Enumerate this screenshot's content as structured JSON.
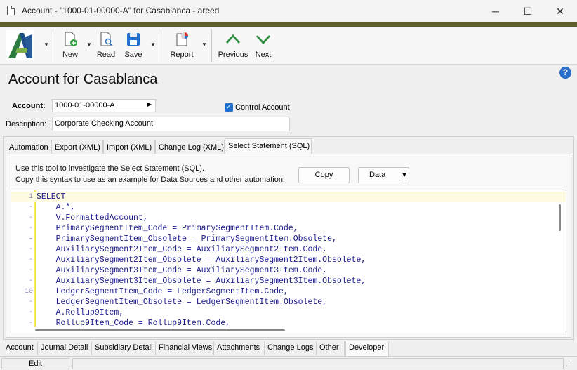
{
  "window": {
    "title": "Account - \"1000-01-00000-A\" for Casablanca - areed",
    "minimize": "─",
    "maximize": "☐",
    "close": "✕"
  },
  "toolbar": {
    "accent_color": "#5d5f2a",
    "buttons": [
      {
        "label": "New",
        "icon": "new-document-icon"
      },
      {
        "label": "Read",
        "icon": "read-document-icon"
      },
      {
        "label": "Save",
        "icon": "save-disk-icon"
      },
      {
        "label": "Report",
        "icon": "report-chart-icon"
      },
      {
        "label": "Previous",
        "icon": "chevron-up-icon"
      },
      {
        "label": "Next",
        "icon": "chevron-down-icon"
      }
    ]
  },
  "page": {
    "title": "Account for Casablanca",
    "help": "?"
  },
  "form": {
    "account_label": "Account:",
    "account_value": "1000-01-00000-A",
    "description_label": "Description:",
    "description_value": "Corporate Checking Account",
    "control_account_label": "Control Account",
    "control_account_checked": true
  },
  "upper_tabs": [
    "Automation",
    "Export (XML)",
    "Import (XML)",
    "Change Log (XML)",
    "Select Statement (SQL)"
  ],
  "active_upper_tab": "Select Statement (SQL)",
  "sql_panel": {
    "info_line1": "Use this tool to investigate the Select Statement (SQL).",
    "info_line2": "Copy this syntax to use as an example for Data Sources and other automation.",
    "copy_button": "Copy",
    "data_button": "Data"
  },
  "sql_lines": [
    {
      "num": "1",
      "text": "SELECT"
    },
    {
      "num": "-",
      "text": "    A.*,"
    },
    {
      "num": "-",
      "text": "    V.FormattedAccount,"
    },
    {
      "num": "-",
      "text": "    PrimarySegmentItem_Code = PrimarySegmentItem.Code,"
    },
    {
      "num": "–",
      "text": "    PrimarySegmentItem_Obsolete = PrimarySegmentItem.Obsolete,"
    },
    {
      "num": "-",
      "text": "    AuxiliarySegment2Item_Code = AuxiliarySegment2Item.Code,"
    },
    {
      "num": "-",
      "text": "    AuxiliarySegment2Item_Obsolete = AuxiliarySegment2Item.Obsolete,"
    },
    {
      "num": "-",
      "text": "    AuxiliarySegment3Item_Code = AuxiliarySegment3Item.Code,"
    },
    {
      "num": "-",
      "text": "    AuxiliarySegment3Item_Obsolete = AuxiliarySegment3Item.Obsolete,"
    },
    {
      "num": "10",
      "text": "    LedgerSegmentItem_Code = LedgerSegmentItem.Code,"
    },
    {
      "num": "-",
      "text": "    LedgerSegmentItem_Obsolete = LedgerSegmentItem.Obsolete,"
    },
    {
      "num": "-",
      "text": "    A.Rollup9Item,"
    },
    {
      "num": "-",
      "text": "    Rollup9Item_Code = Rollup9Item.Code,"
    }
  ],
  "bottom_tabs": [
    "Account",
    "Journal Detail",
    "Subsidiary Detail",
    "Financial Views",
    "Attachments",
    "Change Logs",
    "Other",
    "Developer"
  ],
  "active_bottom_tab": "Developer",
  "status": {
    "mode": "Edit"
  }
}
